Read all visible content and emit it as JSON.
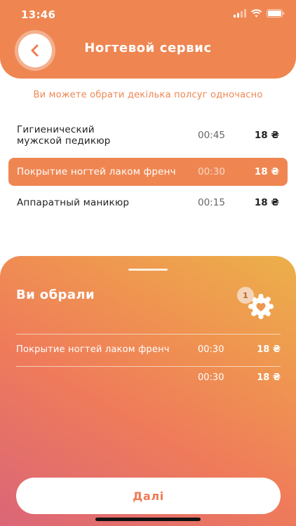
{
  "status_bar": {
    "time": "13:46"
  },
  "header": {
    "title": "Ногтевой сервис"
  },
  "hint": "Ви можете обрати декілька полсуг одночасно",
  "services": [
    {
      "name": "Гигиенический\nмужской педикюр",
      "duration": "00:45",
      "price": "18 ₴",
      "selected": false
    },
    {
      "name": "Покрытие ногтей лаком френч",
      "duration": "00:30",
      "price": "18 ₴",
      "selected": true
    },
    {
      "name": "Аппаратный маникюр",
      "duration": "00:15",
      "price": "18 ₴",
      "selected": false
    }
  ],
  "summary": {
    "title": "Ви обрали",
    "badge_count": "1",
    "badge_icon": "heart-gear-icon",
    "items": [
      {
        "name": "Покрытие ногтей лаком френч",
        "duration": "00:30",
        "price": "18 ₴"
      },
      {
        "name": "",
        "duration": "00:30",
        "price": "18 ₴"
      }
    ],
    "next_label": "Далі"
  },
  "colors": {
    "accent": "#ef8652",
    "sheet_gradient": [
      "#db6678",
      "#ef7b5a",
      "#ecb04a"
    ]
  }
}
